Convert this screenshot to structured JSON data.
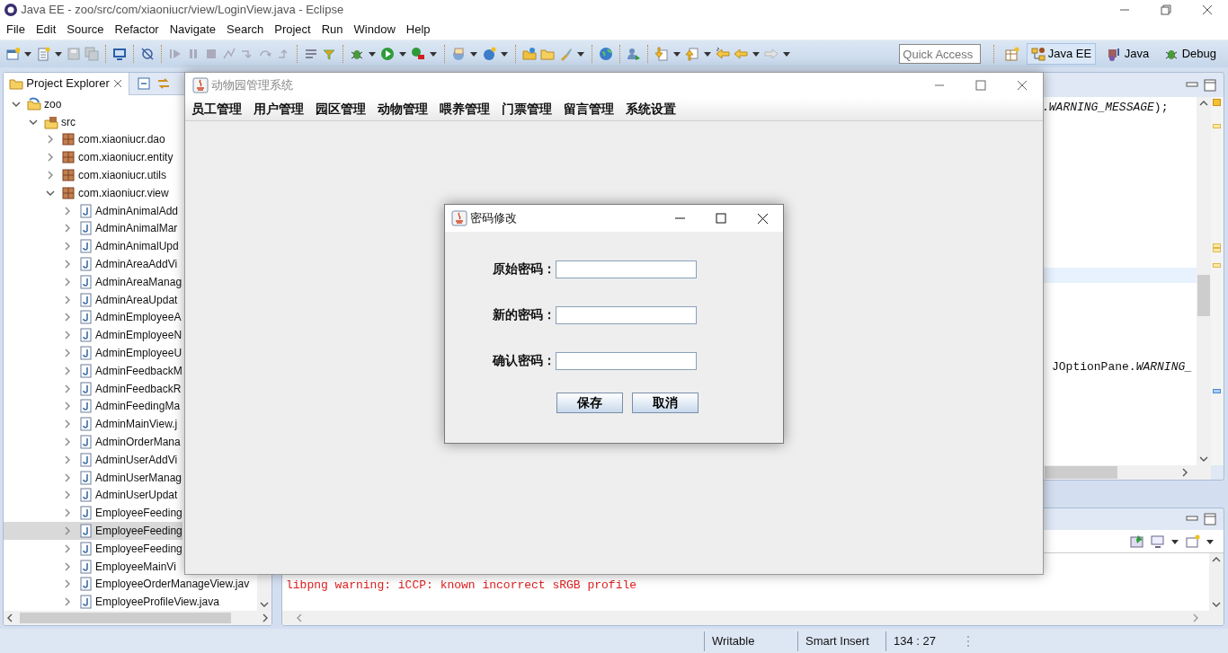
{
  "window": {
    "title": "Java EE - zoo/src/com/xiaoniucr/view/LoginView.java - Eclipse"
  },
  "menu": [
    "File",
    "Edit",
    "Source",
    "Refactor",
    "Navigate",
    "Search",
    "Project",
    "Run",
    "Window",
    "Help"
  ],
  "quick_access": {
    "placeholder": "Quick Access"
  },
  "perspectives": [
    {
      "label": "Java EE",
      "selected": true
    },
    {
      "label": "Java",
      "selected": false
    },
    {
      "label": "Debug",
      "selected": false
    }
  ],
  "project_explorer": {
    "title": "Project Explorer",
    "tree": [
      {
        "label": "zoo",
        "kind": "project",
        "expanded": true,
        "selected": false,
        "children": [
          {
            "label": "src",
            "kind": "source_folder",
            "expanded": true,
            "selected": false,
            "children": [
              {
                "label": "com.xiaoniucr.dao",
                "kind": "package",
                "expanded": false,
                "selected": false
              },
              {
                "label": "com.xiaoniucr.entity",
                "kind": "package",
                "expanded": false,
                "selected": false
              },
              {
                "label": "com.xiaoniucr.utils",
                "kind": "package",
                "expanded": false,
                "selected": false
              },
              {
                "label": "com.xiaoniucr.view",
                "kind": "package",
                "expanded": true,
                "selected": false,
                "children": [
                  {
                    "label": "AdminAnimalAdd",
                    "kind": "file",
                    "expanded": false,
                    "selected": false
                  },
                  {
                    "label": "AdminAnimalMar",
                    "kind": "file",
                    "expanded": false,
                    "selected": false
                  },
                  {
                    "label": "AdminAnimalUpd",
                    "kind": "file",
                    "expanded": false,
                    "selected": false
                  },
                  {
                    "label": "AdminAreaAddVi",
                    "kind": "file",
                    "expanded": false,
                    "selected": false
                  },
                  {
                    "label": "AdminAreaManag",
                    "kind": "file",
                    "expanded": false,
                    "selected": false
                  },
                  {
                    "label": "AdminAreaUpdat",
                    "kind": "file",
                    "expanded": false,
                    "selected": false
                  },
                  {
                    "label": "AdminEmployeeA",
                    "kind": "file",
                    "expanded": false,
                    "selected": false
                  },
                  {
                    "label": "AdminEmployeeN",
                    "kind": "file",
                    "expanded": false,
                    "selected": false
                  },
                  {
                    "label": "AdminEmployeeU",
                    "kind": "file",
                    "expanded": false,
                    "selected": false
                  },
                  {
                    "label": "AdminFeedbackM",
                    "kind": "file",
                    "expanded": false,
                    "selected": false
                  },
                  {
                    "label": "AdminFeedbackR",
                    "kind": "file",
                    "expanded": false,
                    "selected": false
                  },
                  {
                    "label": "AdminFeedingMa",
                    "kind": "file",
                    "expanded": false,
                    "selected": false
                  },
                  {
                    "label": "AdminMainView.j",
                    "kind": "file",
                    "expanded": false,
                    "selected": false
                  },
                  {
                    "label": "AdminOrderMana",
                    "kind": "file",
                    "expanded": false,
                    "selected": false
                  },
                  {
                    "label": "AdminUserAddVi",
                    "kind": "file",
                    "expanded": false,
                    "selected": false
                  },
                  {
                    "label": "AdminUserManag",
                    "kind": "file",
                    "expanded": false,
                    "selected": false
                  },
                  {
                    "label": "AdminUserUpdat",
                    "kind": "file",
                    "expanded": false,
                    "selected": false
                  },
                  {
                    "label": "EmployeeFeeding",
                    "kind": "file",
                    "expanded": false,
                    "selected": false
                  },
                  {
                    "label": "EmployeeFeeding",
                    "kind": "file",
                    "expanded": false,
                    "selected": true
                  },
                  {
                    "label": "EmployeeFeeding",
                    "kind": "file",
                    "expanded": false,
                    "selected": false
                  },
                  {
                    "label": "EmployeeMainVi",
                    "kind": "file",
                    "expanded": false,
                    "selected": false
                  },
                  {
                    "label": "EmployeeOrderManageView.jav",
                    "kind": "file",
                    "expanded": false,
                    "selected": false
                  },
                  {
                    "label": "EmployeeProfileView.java",
                    "kind": "file",
                    "expanded": false,
                    "selected": false
                  }
                ]
              }
            ]
          }
        ]
      }
    ]
  },
  "editor": {
    "lines": [
      ".*WARNING_MESSAGE*);",
      "JOptionPane.*WARNING_*"
    ]
  },
  "console": {
    "lines": [
      "libpng warning: iCCP: known incorrect sRGB profile"
    ]
  },
  "status_bar": [
    "Writable",
    "Smart Insert",
    "134 : 27"
  ],
  "app_window": {
    "title": "动物园管理系统",
    "menu": [
      "员工管理",
      "用户管理",
      "园区管理",
      "动物管理",
      "喂养管理",
      "门票管理",
      "留言管理",
      "系统设置"
    ]
  },
  "dialog": {
    "title": "密码修改",
    "fields": [
      {
        "label": "原始密码："
      },
      {
        "label": "新的密码："
      },
      {
        "label": "确认密码："
      }
    ],
    "buttons": [
      "保存",
      "取消"
    ]
  }
}
